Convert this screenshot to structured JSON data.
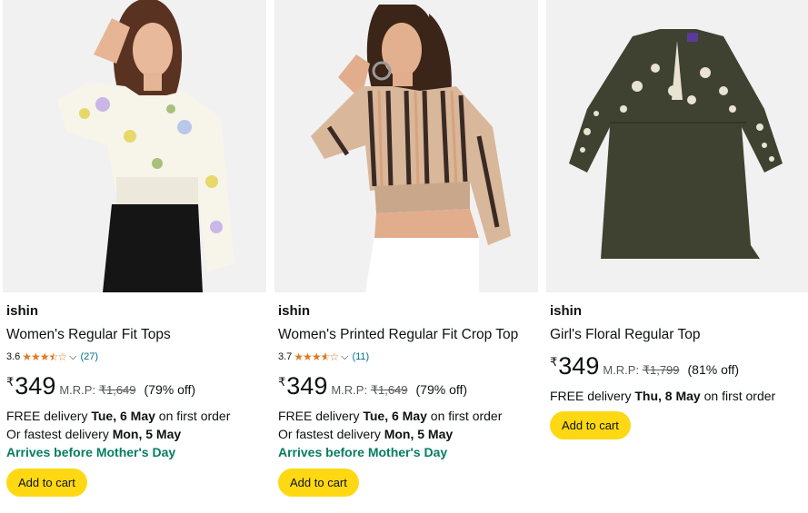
{
  "products": [
    {
      "brand": "ishin",
      "title": "Women's Regular Fit Tops",
      "rating": "3.6",
      "review_count": "(27)",
      "currency": "₹",
      "price": "349",
      "mrp_label": "M.R.P:",
      "mrp": "₹1,649",
      "discount": "(79% off)",
      "delivery_prefix": "FREE delivery ",
      "delivery_date": "Tue, 6 May",
      "delivery_suffix": " on first order",
      "fastest_prefix": "Or fastest delivery ",
      "fastest_date": "Mon, 5 May",
      "badge": "Arrives before Mother's Day",
      "cart_label": "Add to cart"
    },
    {
      "brand": "ishin",
      "title": "Women's Printed Regular Fit Crop Top",
      "rating": "3.7",
      "review_count": "(11)",
      "currency": "₹",
      "price": "349",
      "mrp_label": "M.R.P:",
      "mrp": "₹1,649",
      "discount": "(79% off)",
      "delivery_prefix": "FREE delivery ",
      "delivery_date": "Tue, 6 May",
      "delivery_suffix": " on first order",
      "fastest_prefix": "Or fastest delivery ",
      "fastest_date": "Mon, 5 May",
      "badge": "Arrives before Mother's Day",
      "cart_label": "Add to cart"
    },
    {
      "brand": "ishin",
      "title": "Girl's Floral Regular Top",
      "currency": "₹",
      "price": "349",
      "mrp_label": "M.R.P:",
      "mrp": "₹1,799",
      "discount": "(81% off)",
      "delivery_prefix": "FREE delivery ",
      "delivery_date": "Thu, 8 May",
      "delivery_suffix": " on first order",
      "cart_label": "Add to cart"
    }
  ],
  "colors": {
    "star": "#de7921",
    "link": "#007185",
    "badge_green": "#067d62",
    "cart_button": "#ffd814",
    "mrp_gray": "#565959"
  },
  "icons": {
    "star_full": "★",
    "star_empty": "☆",
    "chevron": "chevron-down-icon"
  }
}
